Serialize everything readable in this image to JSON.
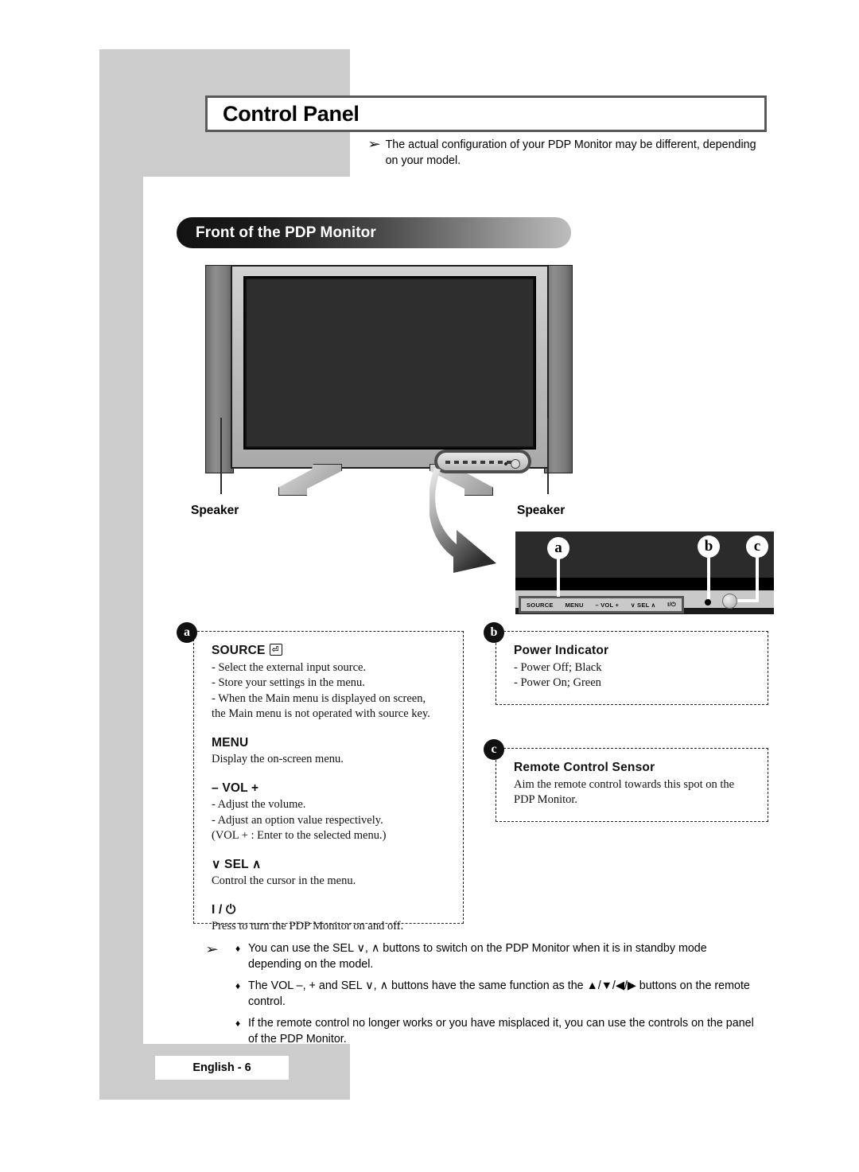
{
  "page": {
    "title": "Control Panel",
    "top_note_bullet": "➢",
    "top_note": "The actual configuration of your PDP Monitor may be different, depending on your model.",
    "section_heading": "Front of the PDP Monitor",
    "footer": "English - 6"
  },
  "illustration": {
    "speaker_left_label": "Speaker",
    "speaker_right_label": "Speaker",
    "callout_letters": {
      "a": "a",
      "b": "b",
      "c": "c"
    },
    "panel_buttons": [
      "SOURCE",
      "MENU",
      "–  VOL  +",
      "∨  SEL  ∧",
      "I/⏻"
    ]
  },
  "boxes": {
    "a": {
      "tag": "a",
      "entries": [
        {
          "heading": "SOURCE",
          "heading_icon": "enter-icon",
          "lines": [
            "- Select the external input source.",
            "- Store your settings in the menu.",
            "- When the Main menu is displayed on screen,",
            "   the Main menu is not operated with source key."
          ]
        },
        {
          "heading": "MENU",
          "lines": [
            "Display the on-screen menu."
          ]
        },
        {
          "heading": "– VOL +",
          "lines": [
            "- Adjust the volume.",
            "- Adjust an option value respectively.",
            "(VOL + : Enter to the selected menu.)"
          ]
        },
        {
          "heading": "∨ SEL ∧",
          "lines": [
            "Control the cursor in the menu."
          ]
        },
        {
          "heading": "I / ⏻",
          "lines": [
            "Press to turn the PDP Monitor on and off."
          ]
        }
      ]
    },
    "b": {
      "tag": "b",
      "heading": "Power Indicator",
      "lines": [
        "- Power Off; Black",
        "- Power On; Green"
      ]
    },
    "c": {
      "tag": "c",
      "heading": "Remote Control Sensor",
      "lines": [
        "Aim the remote control towards this spot on the",
        "PDP Monitor."
      ]
    }
  },
  "notes": {
    "arrow": "➢",
    "diamond": "♦",
    "items": [
      "You can use the SEL ∨, ∧ buttons to switch on the PDP Monitor when it is in standby mode depending on the model.",
      "The VOL –, + and SEL ∨, ∧ buttons have the same function as the ▲/▼/◀/▶ buttons on the remote control.",
      "If the remote control no longer works or you have misplaced it, you can use the controls on the panel of the PDP Monitor."
    ]
  },
  "colors": {
    "page_gray": "#cccccc",
    "title_border": "#5a5a5a",
    "pill_dark": "#121212",
    "pill_light": "#bdbdbd"
  }
}
